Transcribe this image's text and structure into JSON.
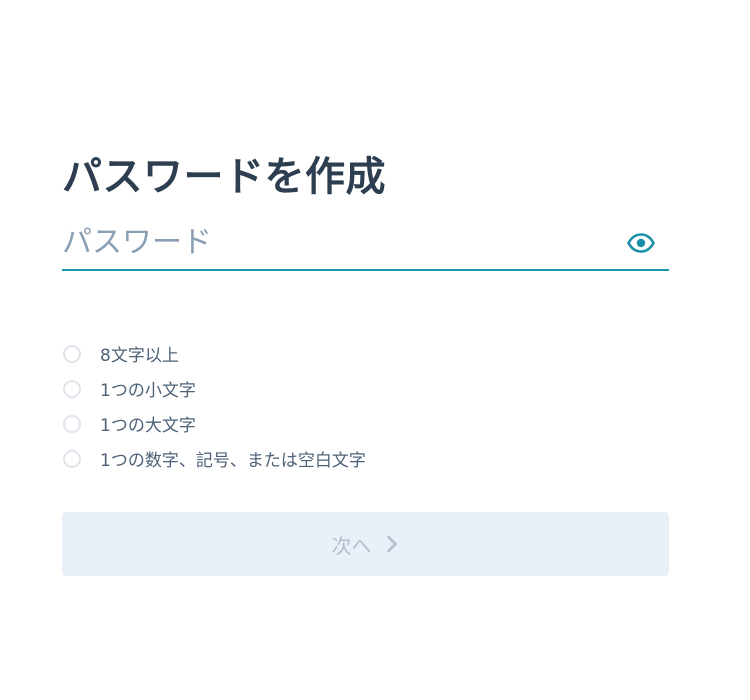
{
  "form": {
    "title": "パスワードを作成",
    "password": {
      "value": "",
      "placeholder": "パスワード",
      "toggle_icon": "eye-icon"
    },
    "requirements": [
      {
        "label": "8文字以上",
        "met": false
      },
      {
        "label": "1つの小文字",
        "met": false
      },
      {
        "label": "1つの大文字",
        "met": false
      },
      {
        "label": "1つの数字、記号、または空白文字",
        "met": false
      }
    ],
    "next_button": {
      "label": "次へ",
      "icon": "chevron-right-icon",
      "enabled": false
    }
  },
  "colors": {
    "title": "#2d3e50",
    "accent": "#1a99aa",
    "placeholder": "#8a9fb4",
    "requirement_text": "#4d6278",
    "circle_border": "#dfe4ec",
    "button_bg_disabled": "#eaf0f7",
    "button_text_disabled": "#b0bfd0"
  }
}
